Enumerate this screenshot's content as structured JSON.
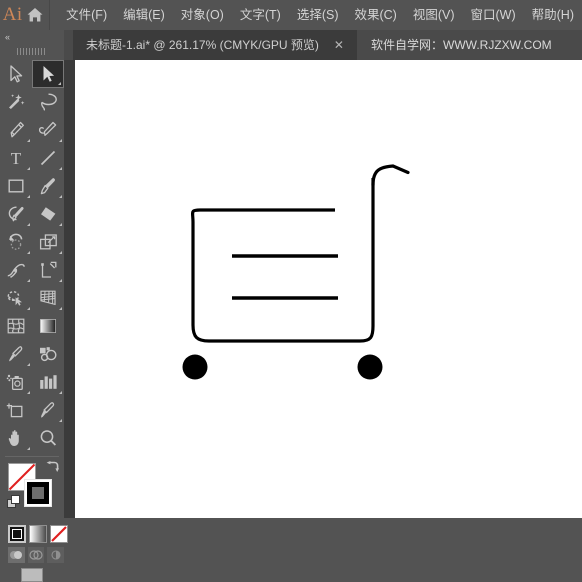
{
  "app": {
    "logo_text": "Ai",
    "home_icon": "home-icon"
  },
  "menubar": {
    "items": [
      {
        "label": "文件(F)",
        "name": "menu-file"
      },
      {
        "label": "编辑(E)",
        "name": "menu-edit"
      },
      {
        "label": "对象(O)",
        "name": "menu-object"
      },
      {
        "label": "文字(T)",
        "name": "menu-type"
      },
      {
        "label": "选择(S)",
        "name": "menu-select"
      },
      {
        "label": "效果(C)",
        "name": "menu-effect"
      },
      {
        "label": "视图(V)",
        "name": "menu-view"
      },
      {
        "label": "窗口(W)",
        "name": "menu-window"
      },
      {
        "label": "帮助(H)",
        "name": "menu-help"
      }
    ]
  },
  "tabbar": {
    "active_tab_title": "未标题-1.ai* @ 261.17% (CMYK/GPU 预览)",
    "close_label": "✕",
    "watermark": "软件自学网：WWW.RJZXW.COM",
    "document_name": "未标题-1.ai*",
    "zoom_level": "261.17%",
    "color_mode": "CMYK/GPU 预览"
  },
  "toolbar": {
    "collapse_label": "«",
    "tools": [
      {
        "name": "selection-tool",
        "label": "选择工具",
        "active": false,
        "has_corner": false
      },
      {
        "name": "direct-selection-tool",
        "label": "直接选择工具",
        "active": true,
        "has_corner": true
      },
      {
        "name": "magic-wand-tool",
        "label": "魔棒工具",
        "active": false,
        "has_corner": false
      },
      {
        "name": "lasso-tool",
        "label": "套索工具",
        "active": false,
        "has_corner": false
      },
      {
        "name": "pen-tool",
        "label": "钢笔工具",
        "active": false,
        "has_corner": true
      },
      {
        "name": "curvature-tool",
        "label": "曲率工具",
        "active": false,
        "has_corner": true
      },
      {
        "name": "type-tool",
        "label": "文字工具",
        "active": false,
        "has_corner": true
      },
      {
        "name": "line-segment-tool",
        "label": "直线段工具",
        "active": false,
        "has_corner": true
      },
      {
        "name": "rectangle-tool",
        "label": "矩形工具",
        "active": false,
        "has_corner": true
      },
      {
        "name": "paintbrush-tool",
        "label": "画笔工具",
        "active": false,
        "has_corner": true
      },
      {
        "name": "shaper-tool",
        "label": "Shaper 工具",
        "active": false,
        "has_corner": true
      },
      {
        "name": "eraser-tool",
        "label": "橡皮擦工具",
        "active": false,
        "has_corner": true
      },
      {
        "name": "rotate-tool",
        "label": "旋转工具",
        "active": false,
        "has_corner": true
      },
      {
        "name": "scale-tool",
        "label": "比例缩放工具",
        "active": false,
        "has_corner": true
      },
      {
        "name": "width-tool",
        "label": "宽度工具",
        "active": false,
        "has_corner": true
      },
      {
        "name": "free-transform-tool",
        "label": "自由变换工具",
        "active": false,
        "has_corner": true
      },
      {
        "name": "shape-builder-tool",
        "label": "形状生成器工具",
        "active": false,
        "has_corner": true
      },
      {
        "name": "perspective-grid-tool",
        "label": "透视网格工具",
        "active": false,
        "has_corner": true
      },
      {
        "name": "mesh-tool",
        "label": "网格工具",
        "active": false,
        "has_corner": false
      },
      {
        "name": "gradient-tool",
        "label": "渐变工具",
        "active": false,
        "has_corner": false
      },
      {
        "name": "eyedropper-tool",
        "label": "吸管工具",
        "active": false,
        "has_corner": true
      },
      {
        "name": "blend-tool",
        "label": "混合工具",
        "active": false,
        "has_corner": false
      },
      {
        "name": "symbol-sprayer-tool",
        "label": "符号喷枪工具",
        "active": false,
        "has_corner": true
      },
      {
        "name": "column-graph-tool",
        "label": "柱形图工具",
        "active": false,
        "has_corner": true
      },
      {
        "name": "artboard-tool",
        "label": "画板工具",
        "active": false,
        "has_corner": false
      },
      {
        "name": "slice-tool",
        "label": "切片工具",
        "active": false,
        "has_corner": true
      },
      {
        "name": "hand-tool",
        "label": "抓手工具",
        "active": false,
        "has_corner": true
      },
      {
        "name": "zoom-tool",
        "label": "缩放工具",
        "active": false,
        "has_corner": false
      }
    ],
    "fill_color": "#ffffff",
    "fill_is_none": true,
    "stroke_color": "#000000",
    "filltype": [
      {
        "name": "fill-type-color",
        "label": "颜色",
        "selected": true
      },
      {
        "name": "fill-type-gradient",
        "label": "渐变",
        "selected": false
      },
      {
        "name": "fill-type-none",
        "label": "无",
        "selected": false
      }
    ],
    "drawmodes": [
      {
        "name": "draw-normal-mode",
        "label": "正常绘图",
        "selected": true
      },
      {
        "name": "draw-behind-mode",
        "label": "背面绘图",
        "selected": false
      },
      {
        "name": "draw-inside-mode",
        "label": "内部绘图",
        "selected": false
      }
    ],
    "screenmode_label": "更改屏幕模式"
  },
  "artwork": {
    "title": "购物车图标",
    "stroke_color": "#000000",
    "fill_color": "#000000",
    "shapes": [
      {
        "name": "cart-body-path",
        "type": "rounded-open-rect",
        "stroke_width": 3.2
      },
      {
        "name": "cart-handle-path",
        "type": "curve",
        "stroke_width": 3.2
      },
      {
        "name": "cart-line-upper",
        "type": "line",
        "stroke_width": 3.6
      },
      {
        "name": "cart-line-lower",
        "type": "line",
        "stroke_width": 3.6
      },
      {
        "name": "cart-wheel-left",
        "type": "circle",
        "radius": 12.5
      },
      {
        "name": "cart-wheel-right",
        "type": "circle",
        "radius": 12.5
      }
    ]
  }
}
